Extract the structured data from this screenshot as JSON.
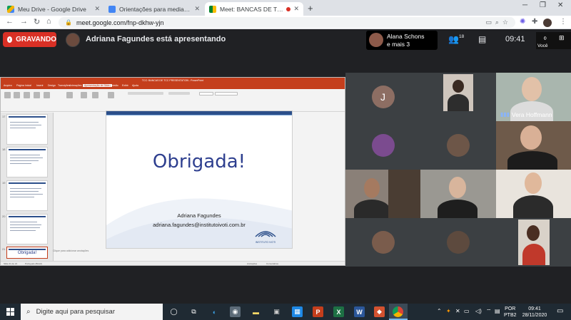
{
  "browser": {
    "tabs": [
      {
        "title": "Meu Drive - Google Drive",
        "icon": "google-drive-icon",
        "active": false
      },
      {
        "title": "Orientações para mediadoras - [",
        "icon": "google-docs-icon",
        "active": false
      },
      {
        "title": "Meet: BANCAS DE TCC SALA",
        "icon": "google-meet-icon",
        "active": true
      }
    ],
    "url": "meet.google.com/fnp-dkhw-yjn"
  },
  "meet": {
    "recording_label": "GRAVANDO",
    "presenting_text": "Adriana Fagundes está apresentando",
    "people_chip": {
      "line1": "Alana Schons",
      "line2": "e mais 3"
    },
    "participant_count": "18",
    "time": "09:41",
    "self_label": "Você",
    "colors": {
      "recording": "#d93025",
      "background": "#202124",
      "tile": "#3c4043"
    }
  },
  "presentation": {
    "app_title": "TCC: BANCAS DE TCC PRESENTATION - PowerPoint",
    "menu_tabs": [
      "Arquivo",
      "Página Inicial",
      "Inserir",
      "Design",
      "Transições",
      "Animações",
      "Apresentação de Slides",
      "Revisão",
      "Exibir",
      "Ajuda"
    ],
    "selected_menu": "Apresentação de Slides",
    "slide": {
      "title": "Obrigada!",
      "author": "Adriana Fagundes",
      "email": "adriana.fagundes@institutoivoti.com.br",
      "logo_text": "INSTITUTO IVOTI"
    },
    "notes_placeholder": "Clique para adicionar anotações",
    "thumbnail_numbers": [
      "17",
      "18",
      "19",
      "20",
      "21"
    ],
    "thumbnail_selected_text": "Obrigada!",
    "status": {
      "slide_counter": "Slide 21 de 21",
      "language": "Português (Brasil)",
      "notes": "Anotações",
      "comments": "Comentários"
    }
  },
  "participants": [
    {
      "label": "J",
      "kind": "avatar",
      "color": "#8d6e63"
    },
    {
      "label": "",
      "kind": "photo"
    },
    {
      "label": "Vera Hoffmann",
      "kind": "video"
    },
    {
      "label": "",
      "kind": "photo"
    },
    {
      "label": "",
      "kind": "photo"
    },
    {
      "label": "",
      "kind": "video"
    },
    {
      "label": "",
      "kind": "video"
    },
    {
      "label": "",
      "kind": "video"
    },
    {
      "label": "",
      "kind": "video"
    },
    {
      "label": "",
      "kind": "photo"
    },
    {
      "label": "",
      "kind": "photo"
    },
    {
      "label": "",
      "kind": "video"
    }
  ],
  "taskbar": {
    "search_placeholder": "Digite aqui para pesquisar",
    "language": "POR",
    "keyboard": "PTB2",
    "time": "09:41",
    "date": "28/11/2020"
  }
}
